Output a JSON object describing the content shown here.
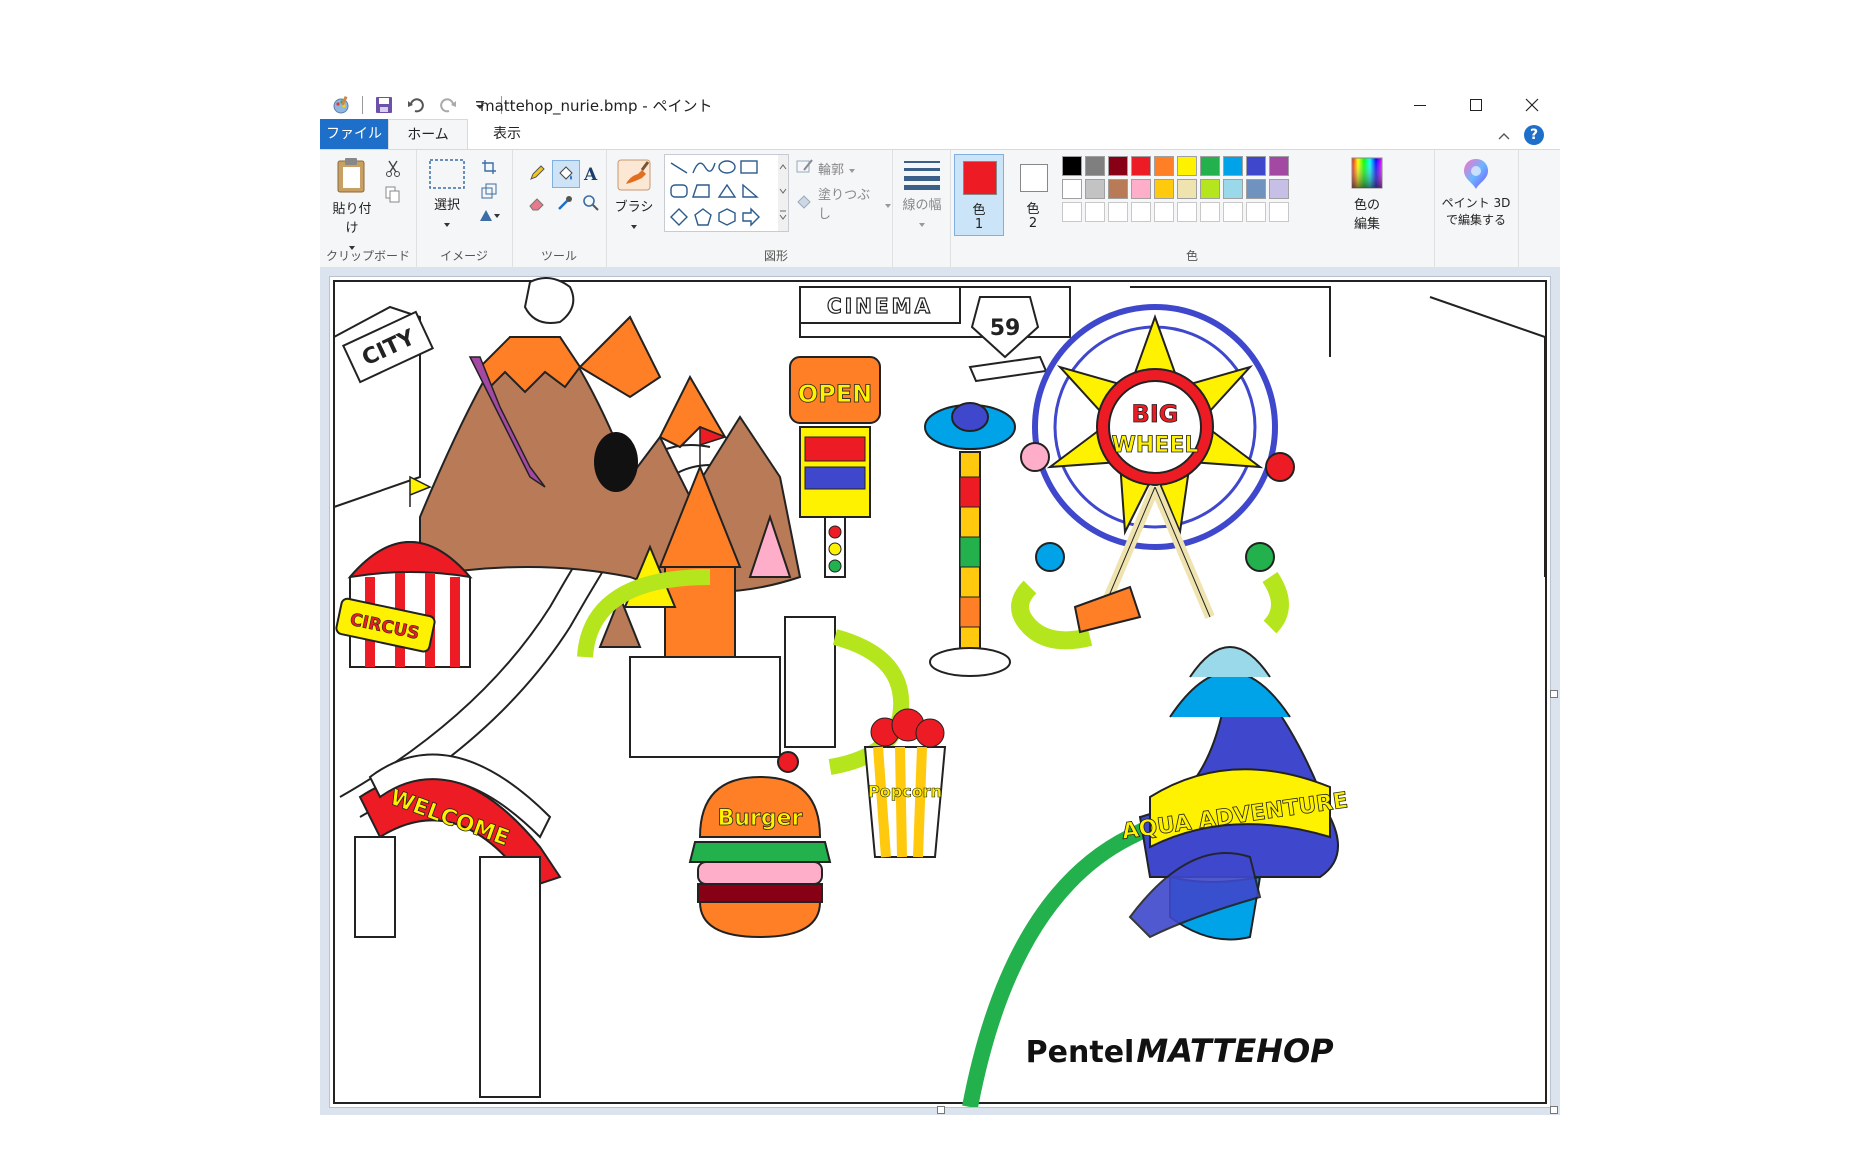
{
  "window": {
    "title": "mattehop_nurie.bmp - ペイント",
    "qat_icons": [
      "paint-app-icon",
      "save-icon",
      "undo-icon",
      "redo-icon",
      "customize-dropdown-icon"
    ]
  },
  "tabs": [
    "ファイル",
    "ホーム",
    "表示"
  ],
  "ribbon": {
    "clipboard": {
      "paste": "貼り付け",
      "group": "クリップボード"
    },
    "image": {
      "select": "選択",
      "group": "イメージ"
    },
    "tools": {
      "group": "ツール"
    },
    "brush": {
      "label": "ブラシ"
    },
    "shapes": {
      "outline": "輪郭",
      "fill": "塗りつぶし",
      "group": "図形"
    },
    "size": {
      "label": "線の幅"
    },
    "colors": {
      "color1_label_a": "色",
      "color1_label_b": "1",
      "color2_label_a": "色",
      "color2_label_b": "2",
      "edit_a": "色の",
      "edit_b": "編集",
      "group": "色",
      "color1": "#ed1c24",
      "color2": "#ffffff",
      "palette_row1": [
        "#000000",
        "#7f7f7f",
        "#880015",
        "#ed1c24",
        "#ff7f27",
        "#fff200",
        "#22b14c",
        "#00a2e8",
        "#3f48cc",
        "#a349a4"
      ],
      "palette_row2": [
        "#ffffff",
        "#c3c3c3",
        "#b97a57",
        "#ffaec9",
        "#ffc90e",
        "#efe4b0",
        "#b5e61d",
        "#99d9ea",
        "#7092be",
        "#c8bfe7"
      ]
    },
    "paint3d": {
      "line1": "ペイント 3D",
      "line2": "で編集する"
    }
  },
  "canvas": {
    "signs": {
      "city": "CITY",
      "cinema": "CINEMA",
      "route": "59",
      "open": "OPEN",
      "big": "BIG",
      "wheel": "WHEEL",
      "circus": "CIRCUS",
      "welcome": "WELCOME",
      "burger": "Burger",
      "popcorn": "Popcorn",
      "aqua": "AQUA ADVENTURE"
    },
    "brand": {
      "pentel": "Pentel",
      "mattehop": "MATTEHOP"
    }
  }
}
